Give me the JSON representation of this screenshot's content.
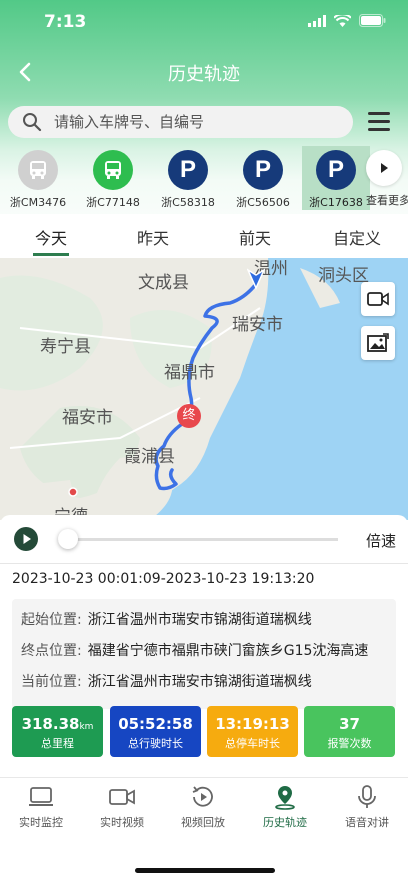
{
  "status_bar": {
    "time": "7:13"
  },
  "nav": {
    "title": "历史轨迹"
  },
  "search": {
    "placeholder": "请输入车牌号、自编号"
  },
  "vehicles": [
    {
      "plate": "浙CM3476",
      "icon": "bus-icon",
      "color": "#d0d0d0"
    },
    {
      "plate": "浙C77148",
      "icon": "bus-icon",
      "color": "#2ebd4f"
    },
    {
      "plate": "浙C58318",
      "icon": "parking-icon",
      "color": "#163a7a"
    },
    {
      "plate": "浙C56506",
      "icon": "parking-icon",
      "color": "#163a7a"
    },
    {
      "plate": "浙C17638",
      "icon": "parking-icon",
      "color": "#163a7a",
      "selected": true
    }
  ],
  "more_label": "查看更多",
  "tabs": [
    "今天",
    "昨天",
    "前天",
    "自定义"
  ],
  "map": {
    "places": [
      "温州",
      "洞头区",
      "文成县",
      "瑞安市",
      "寿宁县",
      "福鼎市",
      "福安市",
      "霞浦县",
      "宁德"
    ],
    "end_marker": "终"
  },
  "playback": {
    "speed_label": "倍速",
    "progress": 0.0
  },
  "time_range": "2023-10-23 00:01:09-2023-10-23 19:13:20",
  "locations": {
    "start": {
      "label": "起始位置:",
      "value": "浙江省温州市瑞安市锦湖街道瑞枫线"
    },
    "end": {
      "label": "终点位置:",
      "value": "福建省宁德市福鼎市硖门畲族乡G15沈海高速"
    },
    "current": {
      "label": "当前位置:",
      "value": "浙江省温州市瑞安市锦湖街道瑞枫线"
    }
  },
  "stats": [
    {
      "value": "318.38",
      "unit": "km",
      "label": "总里程",
      "color": "#1e9b52"
    },
    {
      "value": "05:52:58",
      "unit": "",
      "label": "总行驶时长",
      "color": "#1646c2"
    },
    {
      "value": "13:19:13",
      "unit": "",
      "label": "总停车时长",
      "color": "#f6ab0f"
    },
    {
      "value": "37",
      "unit": "",
      "label": "报警次数",
      "color": "#49c45e"
    }
  ],
  "bottom_nav": [
    {
      "label": "实时监控",
      "icon": "monitor-icon"
    },
    {
      "label": "实时视频",
      "icon": "video-camera-icon"
    },
    {
      "label": "视频回放",
      "icon": "replay-icon"
    },
    {
      "label": "历史轨迹",
      "icon": "location-pin-icon",
      "active": true
    },
    {
      "label": "语音对讲",
      "icon": "microphone-icon"
    }
  ]
}
